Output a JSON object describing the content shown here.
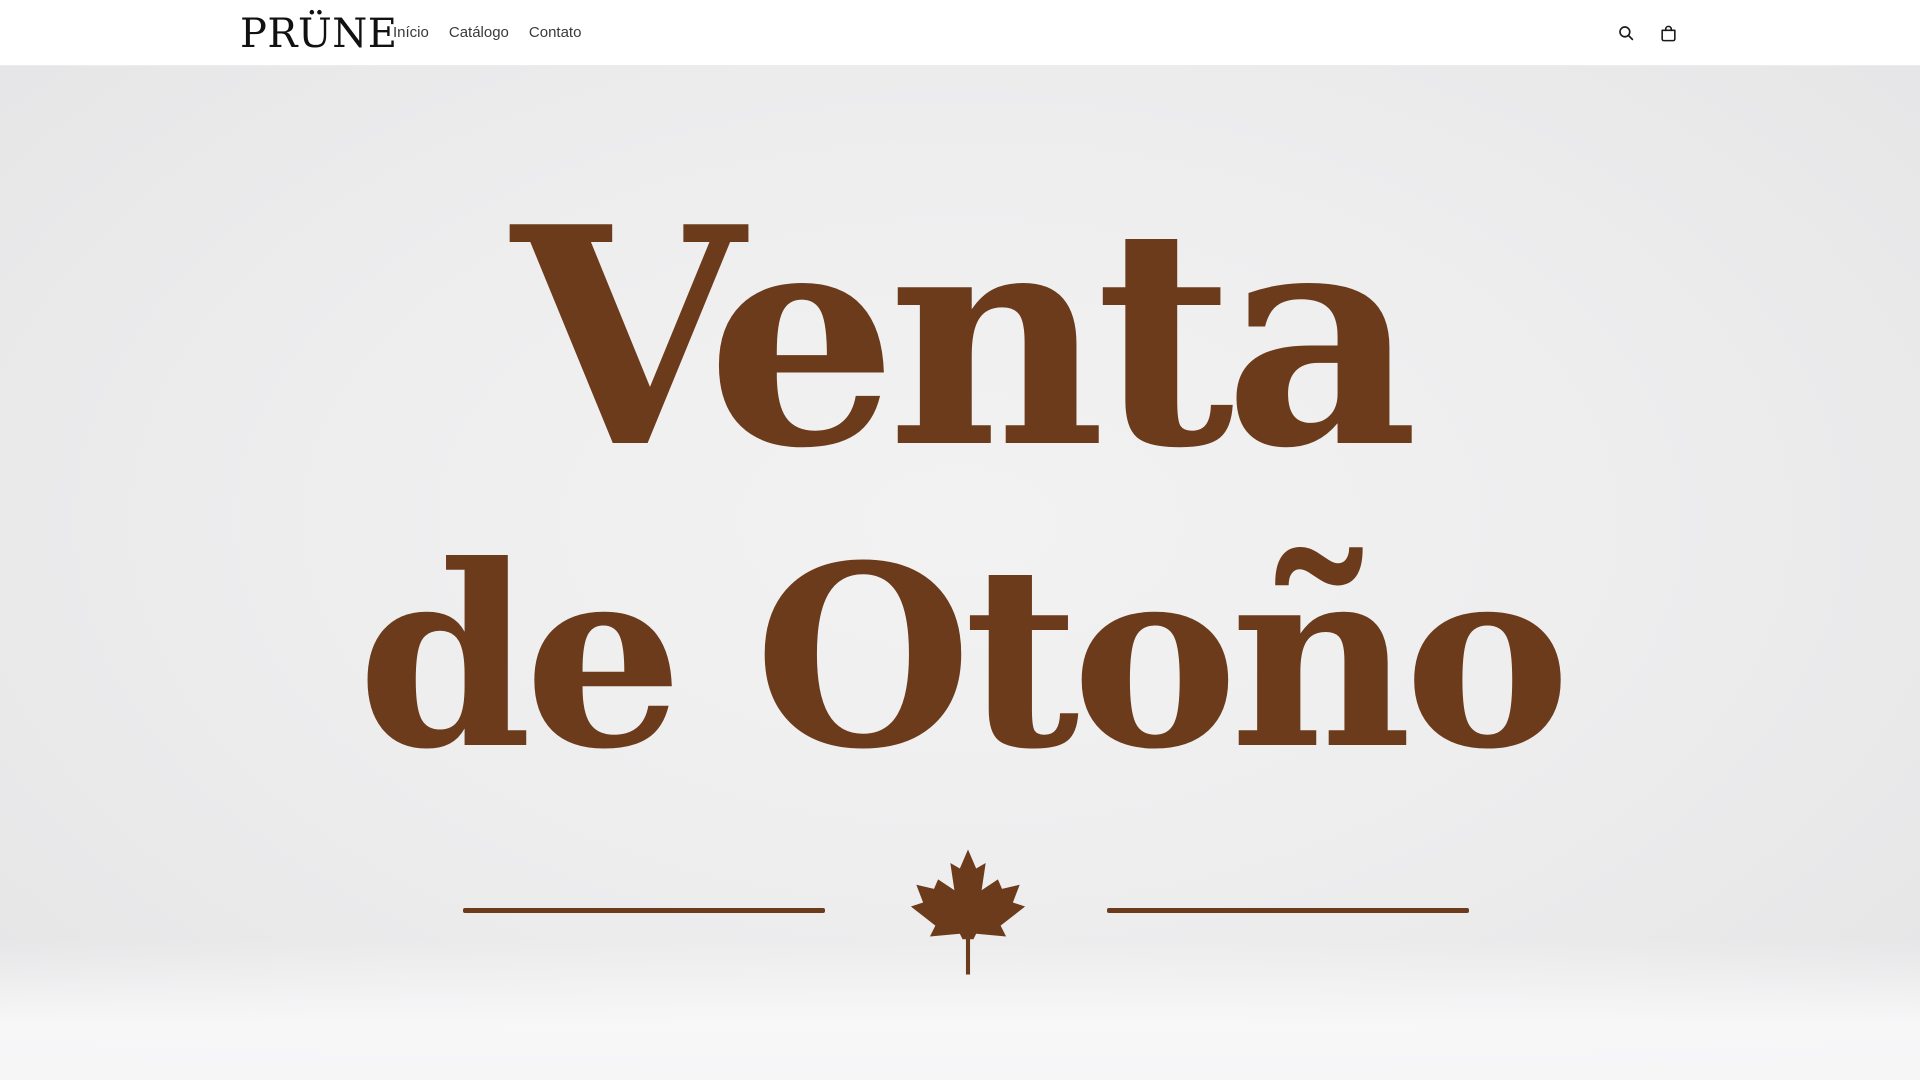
{
  "header": {
    "logo": "PRÜNE",
    "nav": [
      {
        "label": "Início"
      },
      {
        "label": "Catálogo"
      },
      {
        "label": "Contato"
      }
    ],
    "icons": {
      "search": "search-icon",
      "cart": "shopping-bag-icon"
    }
  },
  "hero": {
    "line1": "Venta",
    "line2": "de Otoño",
    "ornament": "maple-leaf-icon",
    "text_color": "#6b3b1c",
    "background_color": "#eeeeef"
  }
}
